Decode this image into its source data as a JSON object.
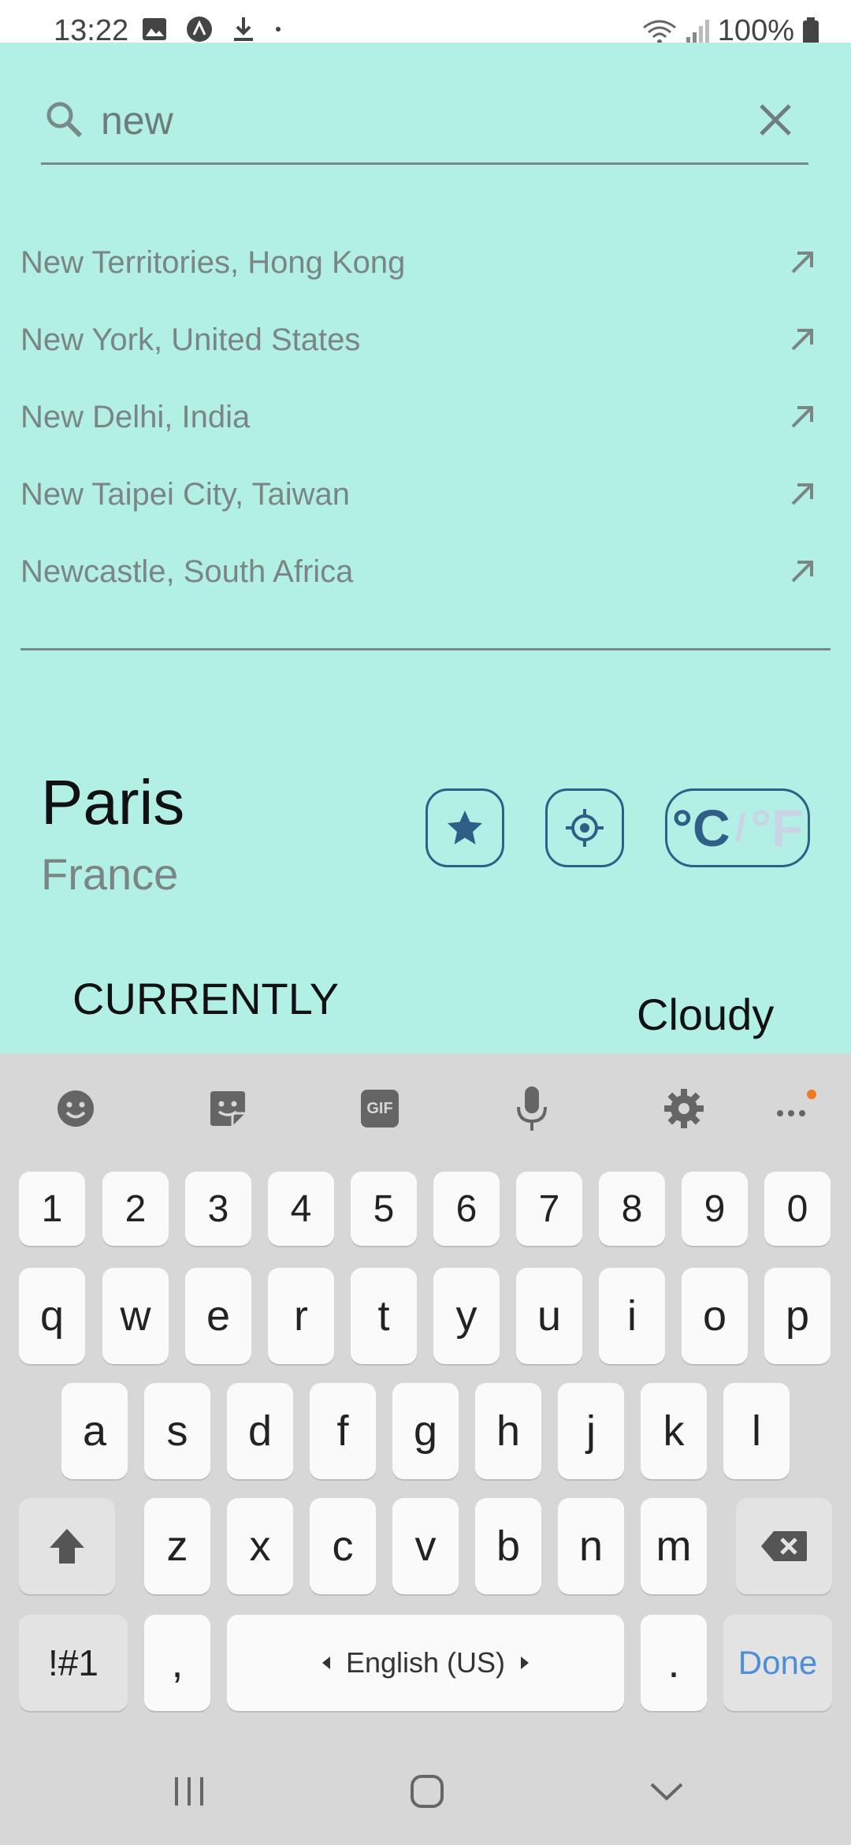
{
  "status_bar": {
    "time": "13:22",
    "battery": "100%"
  },
  "search": {
    "value": "new",
    "placeholder": ""
  },
  "suggestions": [
    "New Territories, Hong Kong",
    "New York, United States",
    "New Delhi, India",
    "New Taipei City, Taiwan",
    "Newcastle, South Africa"
  ],
  "location": {
    "city": "Paris",
    "country": "France"
  },
  "units": {
    "celsius": "°C",
    "separator": "/",
    "fahrenheit": "°F",
    "selected": "celsius"
  },
  "weather": {
    "currently_label": "CURRENTLY",
    "condition": "Cloudy"
  },
  "keyboard": {
    "number_row": [
      "1",
      "2",
      "3",
      "4",
      "5",
      "6",
      "7",
      "8",
      "9",
      "0"
    ],
    "row1": [
      "q",
      "w",
      "e",
      "r",
      "t",
      "y",
      "u",
      "i",
      "o",
      "p"
    ],
    "row2": [
      "a",
      "s",
      "d",
      "f",
      "g",
      "h",
      "j",
      "k",
      "l"
    ],
    "row3": [
      "z",
      "x",
      "c",
      "v",
      "b",
      "n",
      "m"
    ],
    "symbols_label": "!#1",
    "comma": ",",
    "space_label": "English (US)",
    "period": ".",
    "done_label": "Done"
  },
  "colors": {
    "background": "#b2f0e6",
    "accent": "#2f5f86",
    "done": "#4a8fd9"
  }
}
